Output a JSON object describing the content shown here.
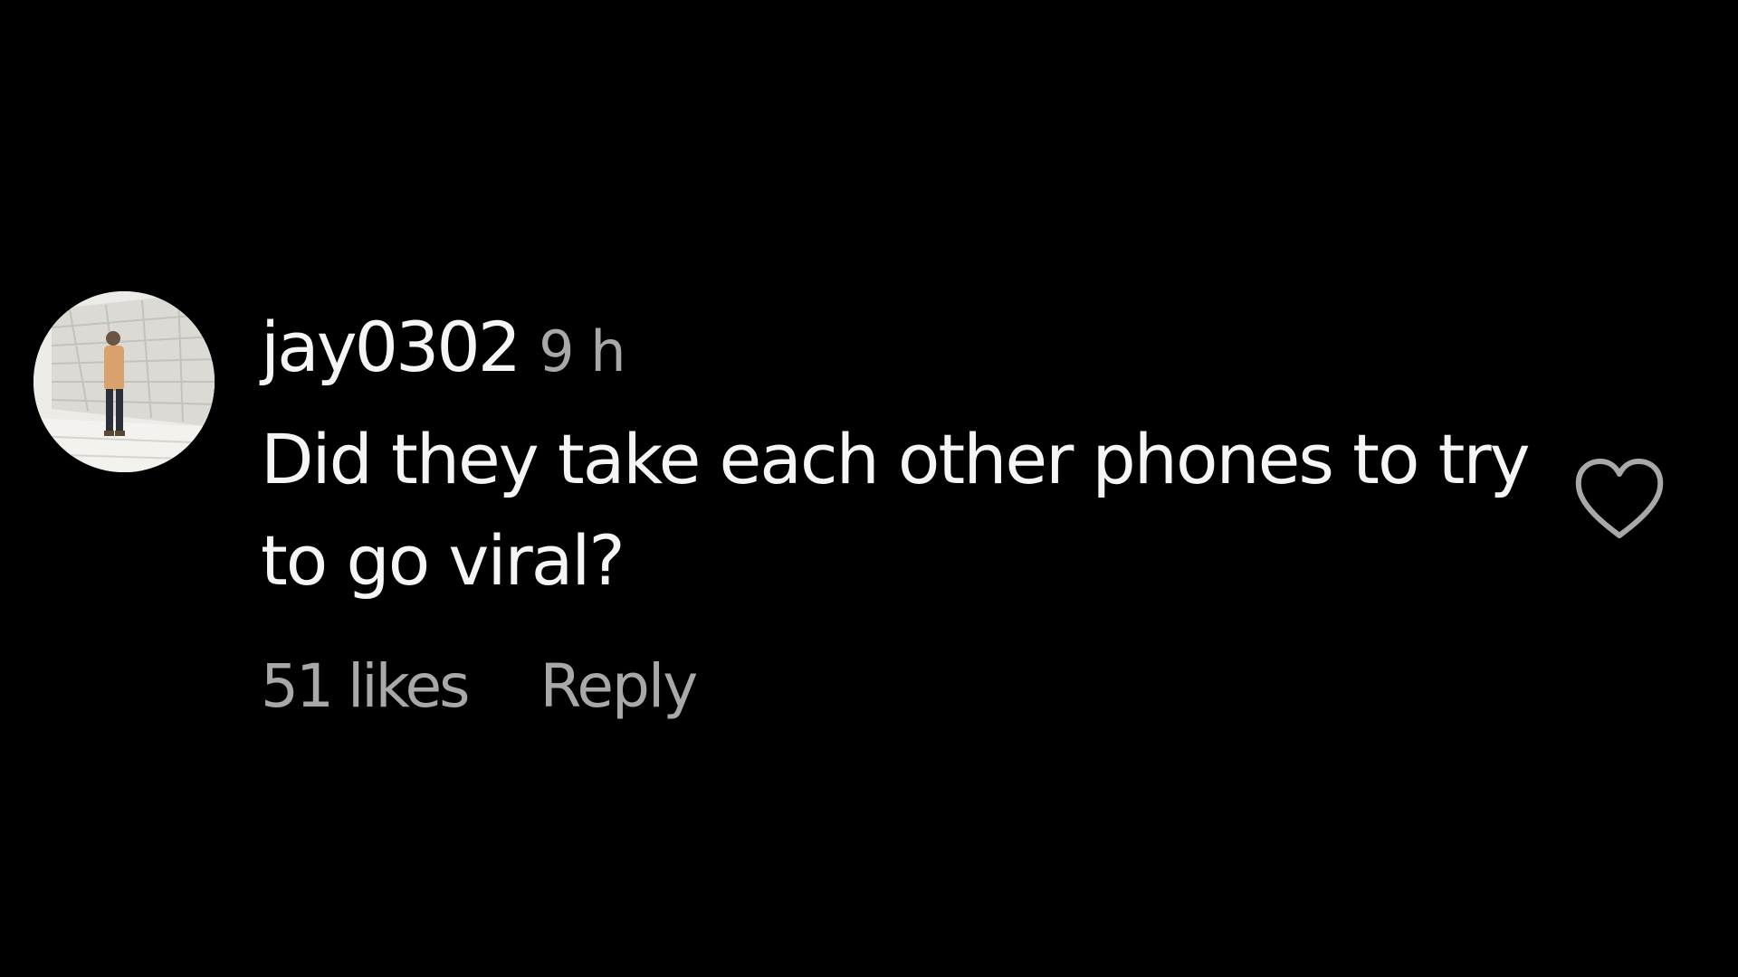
{
  "comment": {
    "username": "jay0302",
    "time_ago": "9 h",
    "text": "Did they take each other phones to try to go viral?",
    "likes_text": "51 likes",
    "reply_label": "Reply",
    "like_icon": "heart-outline-icon"
  },
  "colors": {
    "background": "#000000",
    "primary_text": "#f5f5f5",
    "secondary_text": "#a8a8a8"
  }
}
